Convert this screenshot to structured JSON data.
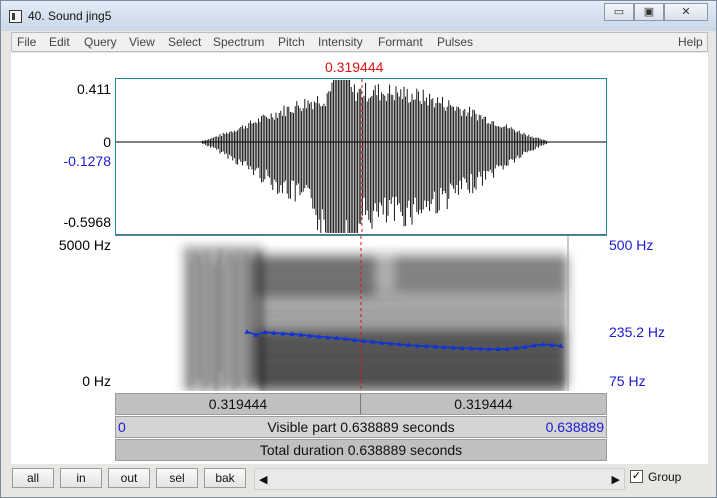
{
  "window": {
    "title": "40. Sound jing5",
    "minimize": "▭",
    "maximize": "▣",
    "close": "✕"
  },
  "menu": [
    "File",
    "Edit",
    "Query",
    "View",
    "Select",
    "Spectrum",
    "Pitch",
    "Intensity",
    "Formant",
    "Pulses"
  ],
  "help": "Help",
  "cursor_time": "0.319444",
  "waveform": {
    "y_max": "0.411",
    "y_zero": "0",
    "y_cursor": "-0.1278",
    "y_min": "-0.5968"
  },
  "spectrogram": {
    "y_top": "5000 Hz",
    "y_bottom": "0 Hz"
  },
  "pitch": {
    "top": "500 Hz",
    "mid": "235.2 Hz",
    "bottom": "75 Hz"
  },
  "bars": {
    "left_time": "0.319444",
    "right_time": "0.319444",
    "visible_start": "0",
    "visible_label": "Visible part 0.638889 seconds",
    "visible_end": "0.638889",
    "total_label": "Total duration 0.638889 seconds"
  },
  "buttons": [
    "all",
    "in",
    "out",
    "sel",
    "bak"
  ],
  "group": {
    "label": "Group",
    "checked": true,
    "mark": "✓"
  },
  "colors": {
    "cursor": "#e01010",
    "pitch": "#1033d8",
    "axis_blue": "#1a1ad6"
  },
  "pitch_track_hz": [
    239,
    231,
    238,
    236,
    234,
    233,
    231,
    228,
    226,
    224,
    222,
    220,
    217,
    214,
    212,
    209,
    207,
    205,
    203,
    201,
    200,
    199,
    197,
    196,
    195,
    194,
    193,
    192,
    192,
    193,
    195,
    198,
    202,
    205,
    203,
    201
  ]
}
